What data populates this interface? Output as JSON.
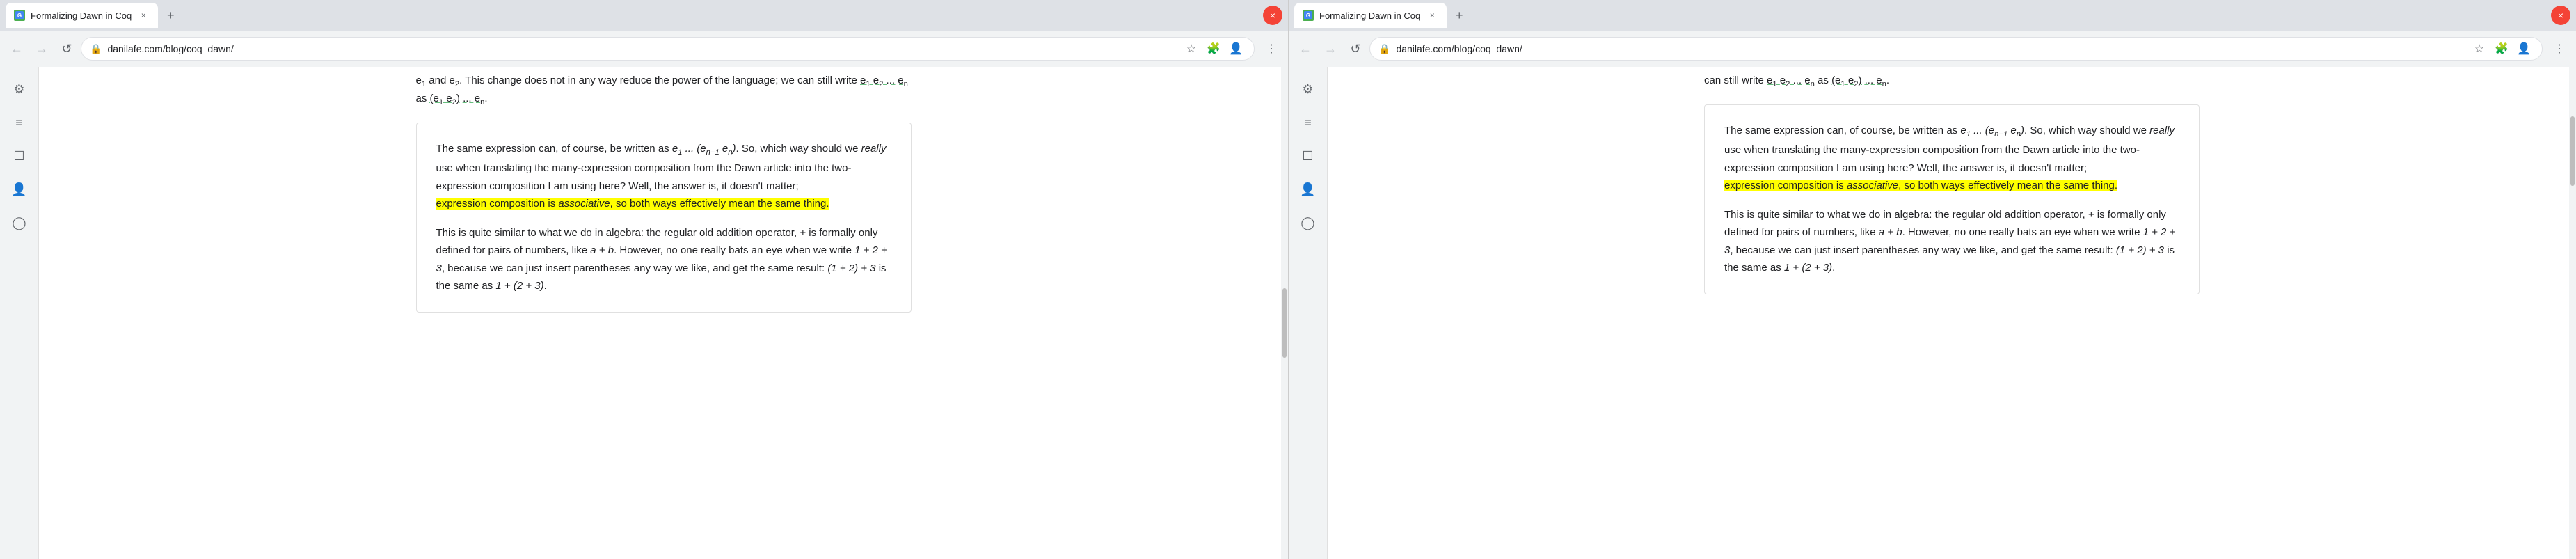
{
  "windows": [
    {
      "id": "window-1",
      "tab": {
        "favicon": "G",
        "title": "Formalizing Dawn in Coq",
        "close": "×"
      },
      "new_tab": "+",
      "window_close": "×",
      "address_bar": {
        "lock_icon": "🔒",
        "url": "danilafe.com/blog/coq_dawn/",
        "star": "☆",
        "extensions": "🧩",
        "profile": "👤",
        "menu": "⋮"
      },
      "nav": {
        "back": "←",
        "forward": "→",
        "reload": "↺"
      },
      "sidebar": {
        "items": [
          {
            "icon": "⚙",
            "name": "settings"
          },
          {
            "icon": "≡",
            "name": "menu"
          },
          {
            "icon": "☐",
            "name": "tabs"
          },
          {
            "icon": "👤",
            "name": "profile"
          },
          {
            "icon": "◯",
            "name": "other"
          }
        ]
      },
      "top_text": {
        "before": "e",
        "sub1": "1",
        "middle1": " and e",
        "sub2": "2",
        "middle2": ". This change does not in any way reduce the power of the language; we can still write ",
        "e1_link": "e₁ e₂ ... eₙ",
        "as_text": " as ",
        "e1e2_link": "(e₁ e₂) ... eₙ",
        "period": "."
      },
      "content_box": {
        "para1": {
          "text1": "The same expression can, of course, be written as ",
          "math1": "e₁ ... (eₙ₋₁ eₙ)",
          "text2": ". So, which way should we ",
          "italic1": "really",
          "text3": " use when translating the many-expression composition from the Dawn article into the two-expression composition I am using here? Well, the answer is, it doesn't matter;",
          "highlighted": " expression composition is ",
          "highlighted_italic": "associative",
          "highlighted2": ", so both ways effectively mean the same thing."
        },
        "para2": {
          "text1": "This is quite similar to what we do in algebra: the regular old addition operator, ",
          "math1": "+",
          "text2": " is formally only defined for pairs of numbers, like ",
          "math2": "a + b",
          "text3": ". However, no one really bats an eye when we write ",
          "math3": "1 + 2 + 3",
          "text4": ", because we can just insert parentheses any way we like, and get the same result: ",
          "math4": "(1 + 2) + 3",
          "text5": " is the same as ",
          "math5": "1 + (2 + 3)",
          "text6": "."
        }
      }
    },
    {
      "id": "window-2",
      "tab": {
        "favicon": "G",
        "title": "Formalizing Dawn in Coq",
        "close": "×"
      },
      "new_tab": "+",
      "window_close": "×",
      "address_bar": {
        "lock_icon": "🔒",
        "url": "danilafe.com/blog/coq_dawn/",
        "star": "☆",
        "extensions": "🧩",
        "profile": "👤",
        "menu": "⋮"
      },
      "nav": {
        "back": "←",
        "forward": "→",
        "reload": "↺"
      },
      "sidebar": {
        "items": [
          {
            "icon": "⚙",
            "name": "settings"
          },
          {
            "icon": "≡",
            "name": "menu"
          },
          {
            "icon": "☐",
            "name": "tabs"
          },
          {
            "icon": "👤",
            "name": "profile"
          },
          {
            "icon": "◯",
            "name": "other"
          }
        ]
      },
      "top_text": {
        "line": "can still write e₁ e₂ ... eₙ as (e₁ e₂) ... eₙ."
      },
      "content_box": {
        "para1": {
          "text1": "The same expression can, of course, be written as ",
          "math1": "e₁ ... (eₙ₋₁ eₙ)",
          "text2": ". So, which way should we ",
          "italic1": "really",
          "text3": " use when translating the many-expression composition from the Dawn article into the two-expression composition I am using here? Well, the answer is, it doesn't matter;",
          "highlighted": " expression composition is ",
          "highlighted_italic": "associative",
          "highlighted2": ", so both ways effectively mean the same thing."
        },
        "para2": {
          "text1": "This is quite similar to what we do in algebra: the regular old addition operator, ",
          "math1": "+",
          "text2": " is formally only defined for pairs of numbers, like ",
          "math2": "a + b",
          "text3": ". However, no one really bats an eye when we write ",
          "math3": "1 + 2 + 3",
          "text4": ", because we can just insert parentheses any way we like, and get the same result: ",
          "math4": "(1 + 2) + 3",
          "text5": " is the same as ",
          "math5": "1 + (2 + 3)",
          "text6": "."
        }
      }
    }
  ],
  "colors": {
    "highlight_yellow": "#ffff00",
    "link_green": "#34a853",
    "tab_bg": "#ffffff",
    "titlebar_bg": "#dee1e6",
    "content_bg": "#ffffff",
    "border": "#e0e0e0",
    "text": "#202124",
    "muted": "#5f6368"
  }
}
